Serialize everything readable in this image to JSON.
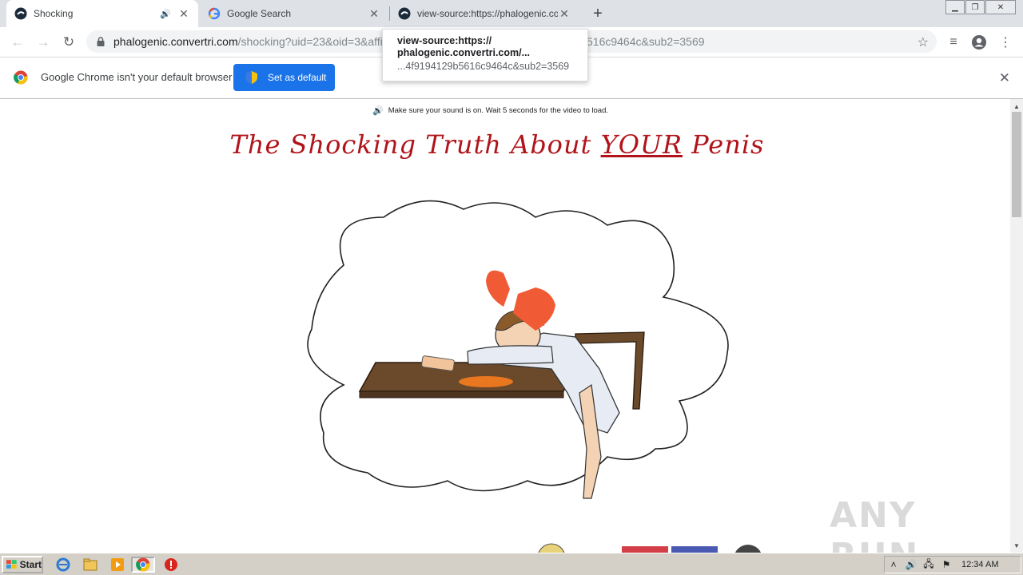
{
  "browser": {
    "tabs": [
      {
        "title": "Shocking",
        "active": true
      },
      {
        "title": "Google Search",
        "active": false
      },
      {
        "title": "view-source:https://phalogenic.convertri.com",
        "active": false
      }
    ],
    "address": {
      "domain": "phalogenic.convertri.com",
      "path_visible": "/shocking?uid=23&oid=3&affi",
      "path_tail": "516c9464c&sub2=3569"
    },
    "tooltip": {
      "line1": "view-source:https://",
      "line2": "phalogenic.convertri.com/...",
      "line3": "...4f9194129b5616c9464c&sub2=3569"
    }
  },
  "infobar": {
    "message": "Google Chrome isn't your default browser",
    "button": "Set as default"
  },
  "page": {
    "notice": "Make sure your sound is on. Wait 5 seconds for the video to load.",
    "headline_pre": "The Shocking Truth About ",
    "headline_emph": "YOUR",
    "headline_post": " Penis"
  },
  "watermark": "ANY RUN",
  "taskbar": {
    "start": "Start",
    "clock": "12:34 AM"
  },
  "colors": {
    "headline": "#b0141a",
    "accent_button": "#1a73e8"
  }
}
